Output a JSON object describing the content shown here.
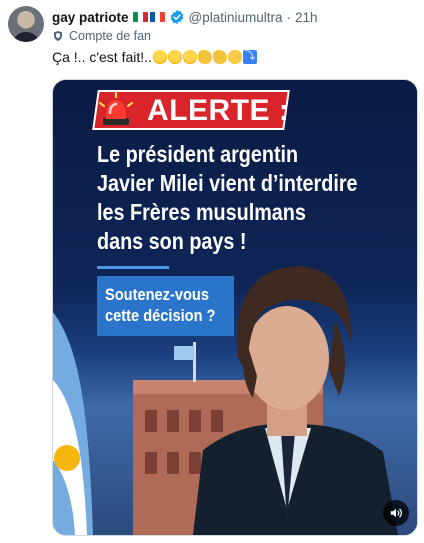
{
  "tweet": {
    "author_name": "gay patriote",
    "handle": "@platiniumultra",
    "separator": "·",
    "time": "21h",
    "fan_label": "Compte de fan",
    "text": "Ça !.. c'est  fait!..",
    "emojis": [
      "rolling-on-floor-laughing",
      "rolling-on-floor-laughing",
      "rolling-on-floor-laughing",
      "flexed-biceps",
      "flexed-biceps",
      "clapping-hands",
      "arrow-curving-down"
    ],
    "flags": [
      "italy",
      "france"
    ]
  },
  "media": {
    "alert_label": "ALERTE :",
    "headline_lines": [
      "Le président argentin",
      "Javier Milei vient d’interdire",
      "les Frères musulmans",
      "dans son pays !"
    ],
    "question_lines": [
      "Soutenez-vous",
      "cette décision ?"
    ],
    "volume_icon": "speaker-icon"
  },
  "colors": {
    "alert_red": "#d9252a",
    "question_blue": "#2a74c9",
    "verified_blue": "#1d9bf0",
    "poster_navy": "#0b1b44"
  }
}
